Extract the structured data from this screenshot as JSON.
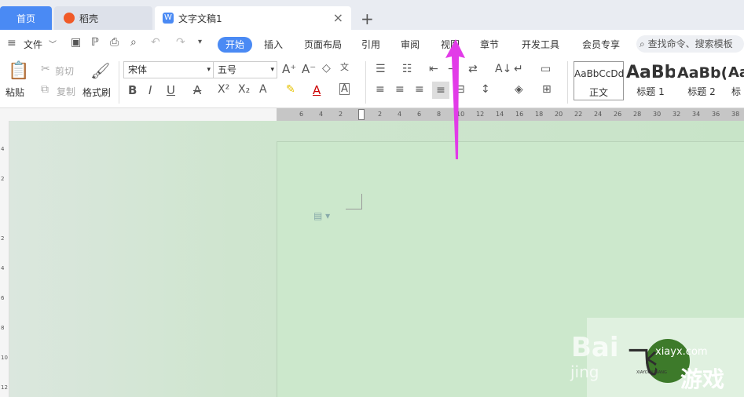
{
  "tabs": {
    "home": "首页",
    "daoke": "稻壳",
    "document": "文字文稿1",
    "add": "+",
    "close": "×"
  },
  "menu": {
    "file": "文件",
    "active": "开始",
    "items": [
      "插入",
      "页面布局",
      "引用",
      "审阅",
      "视图",
      "章节",
      "开发工具",
      "会员专享"
    ],
    "search_placeholder": "查找命令、搜索模板"
  },
  "ribbon": {
    "paste": "粘贴",
    "cut": "剪切",
    "copy": "复制",
    "format_painter": "格式刷",
    "font_name": "宋体",
    "font_size": "五号",
    "styles": [
      {
        "sample": "AaBbCcDd",
        "label": "正文"
      },
      {
        "sample": "AaBb",
        "label": "标题 1"
      },
      {
        "sample": "AaBb(",
        "label": "标题 2"
      },
      {
        "sample": "Aa",
        "label": "标"
      }
    ]
  },
  "ruler": {
    "h_marks": [
      "6",
      "4",
      "2",
      "2",
      "4",
      "6",
      "8",
      "10",
      "12",
      "14",
      "16",
      "18",
      "20",
      "22",
      "24",
      "26",
      "28",
      "30",
      "32",
      "34",
      "36",
      "38"
    ],
    "v_marks": [
      "4",
      "2",
      "2",
      "4",
      "6",
      "8",
      "10",
      "12"
    ]
  },
  "watermark": {
    "baidu": "Bai",
    "jingyan": "jing",
    "site": "xiayx.com",
    "brand": "游戏",
    "small": "XIAYOUXIWANG"
  },
  "colors": {
    "accent": "#4a8af4",
    "arrow": "#e23be8",
    "page_bg": "#cce8cc"
  }
}
